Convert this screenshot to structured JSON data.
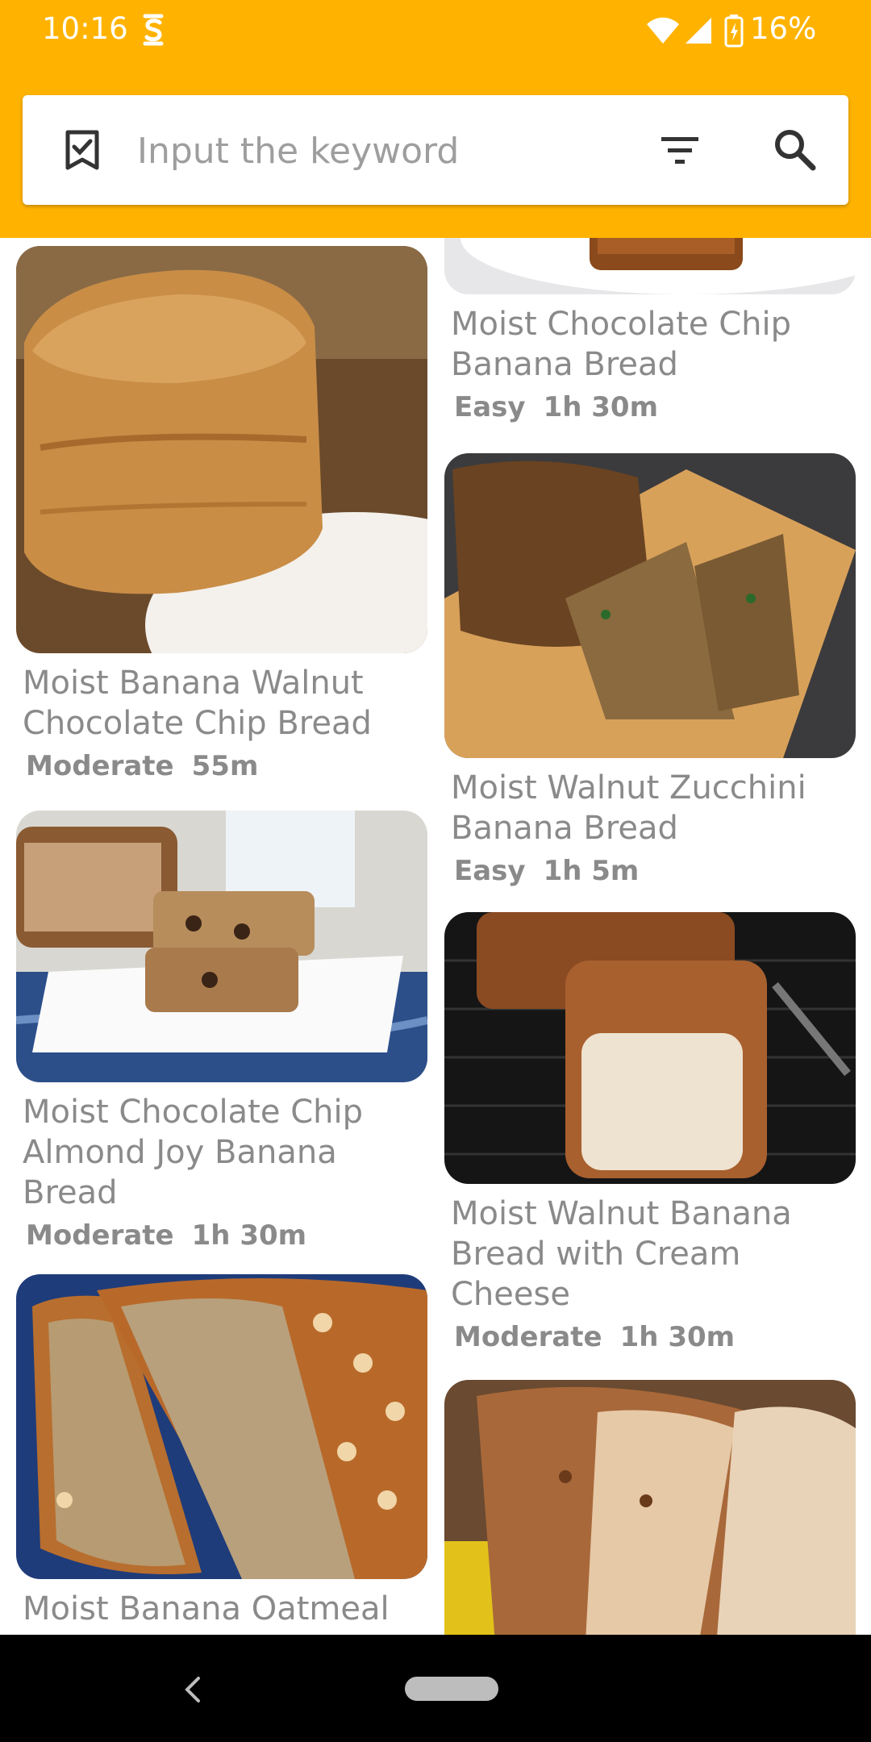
{
  "status_bar": {
    "time": "10:16",
    "battery": "16%",
    "icons": [
      "app-notification-icon",
      "wifi-icon",
      "signal-icon",
      "battery-charging-icon"
    ]
  },
  "search": {
    "placeholder": "Input the keyword",
    "left_icon": "bookmark-check-icon",
    "filter_icon": "filter-icon",
    "search_icon": "search-icon"
  },
  "colors": {
    "accent": "#FFB300",
    "text_gray": "#8a8a8a"
  },
  "recipes": {
    "left": [
      {
        "title": "Moist Banana Walnut Chocolate Chip Bread",
        "difficulty": "Moderate",
        "time": "55m"
      },
      {
        "title": "Moist Chocolate Chip Almond Joy Banana Bread",
        "difficulty": "Moderate",
        "time": "1h 30m"
      },
      {
        "title": "Moist Banana Oatmeal"
      }
    ],
    "right": [
      {
        "title": "Moist Chocolate Chip Banana Bread",
        "difficulty": "Easy",
        "time": "1h 30m"
      },
      {
        "title": "Moist Walnut Zucchini Banana Bread",
        "difficulty": "Easy",
        "time": "1h 5m"
      },
      {
        "title": "Moist Walnut Banana Bread with Cream Cheese",
        "difficulty": "Moderate",
        "time": "1h 30m"
      },
      {}
    ]
  },
  "nav_bar": {
    "icons": [
      "back-icon",
      "home-pill"
    ]
  }
}
